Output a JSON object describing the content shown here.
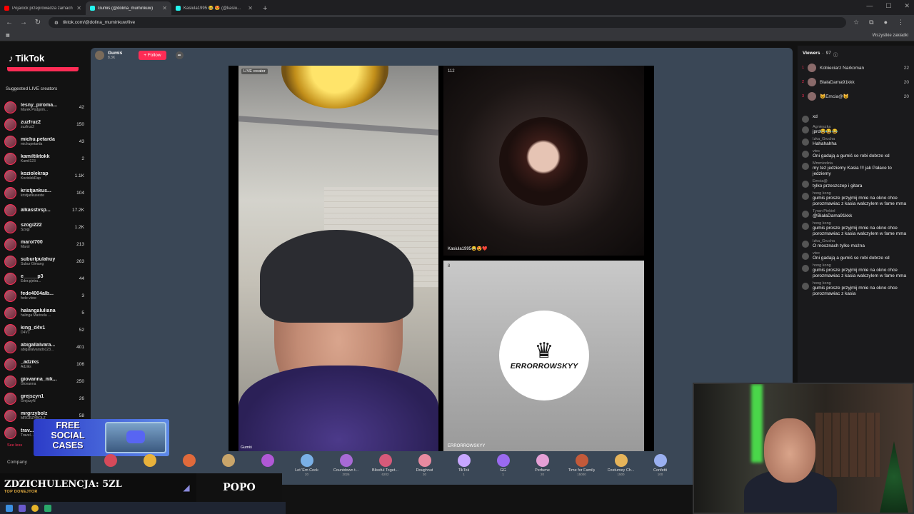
{
  "browser": {
    "tabs": [
      {
        "title": "Pojalock przeprowadza zamach",
        "color": "#ff0000",
        "active": false
      },
      {
        "title": "Gumiś (@dolina_muminkuw)",
        "color": "#25f4ee",
        "active": true
      },
      {
        "title": "Kasiula1995 😂 😍 (@kasiu...",
        "color": "#25f4ee",
        "active": false
      }
    ],
    "new_tab": "+",
    "url": "tiktok.com/@dolina_muminkuw/live",
    "bookmarks_label": "Wszystkie zakładki"
  },
  "sidebar": {
    "logo": "TikTok",
    "suggested_title": "Suggested LIVE creators",
    "creators": [
      {
        "name": "lesny_piroma...",
        "sub": "Marek Podgóm...",
        "count": "42"
      },
      {
        "name": "zuzfruz2",
        "sub": "zuzfruz2",
        "count": "150"
      },
      {
        "name": "michu.petarda",
        "sub": "michupetarda",
        "count": "43"
      },
      {
        "name": "kamiltiktokk",
        "sub": "Kamil123",
        "count": "2"
      },
      {
        "name": "koziolekrap",
        "sub": "KoziolekRap",
        "count": "1.1K"
      },
      {
        "name": "kristjankus...",
        "sub": "kristjankuseste",
        "count": "104"
      },
      {
        "name": "alkasstvsp...",
        "sub": "",
        "count": "17.2K"
      },
      {
        "name": "szogi222",
        "sub": "Szogi",
        "count": "1.2K"
      },
      {
        "name": "marol700",
        "sub": "Marol",
        "count": "213"
      },
      {
        "name": "suburlpulahuy",
        "sub": "Subur Gimang",
        "count": "263"
      },
      {
        "name": "e_____p3",
        "sub": "Eder.pjetra...",
        "count": "44"
      },
      {
        "name": "fede4004alb...",
        "sub": "fede vlore",
        "count": "3"
      },
      {
        "name": "halangaluliana",
        "sub": "halinga Marinela ...",
        "count": "5"
      },
      {
        "name": "king_d4v1",
        "sub": "D4V1",
        "count": "52"
      },
      {
        "name": "abigallalvara...",
        "sub": "abigallalvarado123...",
        "count": "401"
      },
      {
        "name": "_adziks",
        "sub": "Adziks",
        "count": "106"
      },
      {
        "name": "giovanna_nik...",
        "sub": "Giovanna",
        "count": "250"
      },
      {
        "name": "grejszyn1",
        "sub": "GrejszyN",
        "count": "26"
      },
      {
        "name": "mrgrzybolz",
        "sub": "MRGRZYBOLZ",
        "count": "58"
      },
      {
        "name": "trav...",
        "sub": "Travel...",
        "count": ""
      }
    ],
    "see_less": "See less",
    "company": "Company"
  },
  "promo": {
    "text": "FREE SOCIAL CASES"
  },
  "live": {
    "host_name": "Gumiś",
    "host_likes": "8.3K",
    "follow_label": "+ Follow",
    "vid1_label": "LIVE creator",
    "vid1_name": "Gumiś",
    "vid2_count": "112",
    "vid2_name": "Kasiula1995😂😍❤️",
    "vid3_count": "8",
    "vid3_name": "ERRORROWSKYY",
    "vid3_brand": "ERRORROWSKYY"
  },
  "gifts": [
    {
      "name": "",
      "price": "",
      "color": "#d64a5a"
    },
    {
      "name": "",
      "price": "",
      "color": "#e9b23b"
    },
    {
      "name": "",
      "price": "",
      "color": "#e06a3b"
    },
    {
      "name": "",
      "price": "",
      "color": "#c9a56a"
    },
    {
      "name": "",
      "price": "",
      "color": "#b058d6"
    },
    {
      "name": "Let 'Em Cook",
      "price": "20",
      "color": "#7ab0e6"
    },
    {
      "name": "Countdown t...",
      "price": "2026",
      "color": "#a86ad6"
    },
    {
      "name": "Blissful Toget...",
      "price": "6202",
      "color": "#d65a7a"
    },
    {
      "name": "Doughnut",
      "price": "30",
      "color": "#e88aa0"
    },
    {
      "name": "TikTok",
      "price": "1",
      "color": "#c7a6ff"
    },
    {
      "name": "GG",
      "price": "1",
      "color": "#9a6af0"
    },
    {
      "name": "Perfume",
      "price": "20",
      "color": "#e6a0d6"
    },
    {
      "name": "Time for Family",
      "price": "15000",
      "color": "#c45a3a"
    },
    {
      "name": "Costumey Ch...",
      "price": "1500",
      "color": "#e6b45a"
    },
    {
      "name": "Confetti",
      "price": "100",
      "color": "#9ab0f0"
    }
  ],
  "viewers": {
    "title": "Viewers",
    "count": "97",
    "top": [
      {
        "rank": "1",
        "name": "Kobieciarz Narkoman",
        "score": "22"
      },
      {
        "rank": "2",
        "name": "BiałaDama91kkk",
        "score": "20"
      },
      {
        "rank": "3",
        "name": "😺Emcia@😺",
        "score": "20"
      }
    ]
  },
  "chat": [
    {
      "user": "",
      "text": "xd"
    },
    {
      "user": "Agnieszka",
      "text": "jprd😂😂😂"
    },
    {
      "user": "Izka_Grucha",
      "text": "Hahahahha"
    },
    {
      "user": "vtec",
      "text": "Oni gadają a gumiś se robi dobrze xd"
    },
    {
      "user": "Mmmiodzia",
      "text": "my też jedziemy Kasia !!! jak Pałace to jedziemy"
    },
    {
      "user": "Emcia@",
      "text": "tylko przeszczep i gitara"
    },
    {
      "user": "hong kong",
      "text": "gumis prosze przyjmij mnie na okno chce porozmawiac z kasia walczylem w fame mma"
    },
    {
      "user": "Tyran Piekieł",
      "text": "@BiałaDama91kkk"
    },
    {
      "user": "hong kong",
      "text": "gumis prosze przyjmij mnie na okno chce porozmawiac z kasia walczylem w fame mma"
    },
    {
      "user": "Izka_Grucha",
      "text": "O mosznach tylko można"
    },
    {
      "user": "vtec",
      "text": "Oni gadają a gumiś se robi dobrze xd"
    },
    {
      "user": "hong kong",
      "text": "gumis prosze przyjmij mnie na okno chce porozmawiac z kasia walczylem w fame mma"
    },
    {
      "user": "hong kong",
      "text": "gumis prosze przyjmij mnie na okno chce porozmawiac z kasia"
    }
  ],
  "donation": {
    "headline": "ZDZICHULENCJA: 5ZL",
    "sub": "TOP DONEJTOR",
    "right": "POPO"
  }
}
